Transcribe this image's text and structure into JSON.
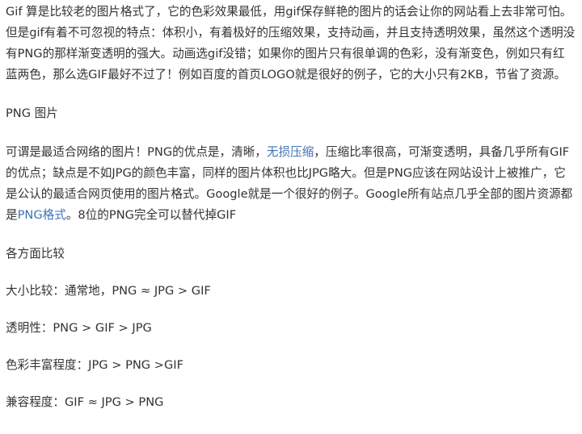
{
  "article": {
    "paragraph_gif": "Gif 算是比较老的图片格式了，它的色彩效果最低，用gif保存鲜艳的图片的话会让你的网站看上去非常可怕。但是gif有着不可忽视的特点：体积小，有着极好的压缩效果，支持动画，并且支持透明效果，虽然这个透明没有PNG的那样渐变透明的强大。动画选gif没错；如果你的图片只有很单调的色彩，没有渐变色，例如只有红蓝两色，那么选GIF最好不过了！例如百度的首页LOGO就是很好的例子，它的大小只有2KB，节省了资源。",
    "heading_png": "PNG 图片",
    "paragraph_png": {
      "part1": "可谓是最适合网络的图片！PNG的优点是，清晰，",
      "link1": "无损压缩",
      "part2": "，压缩比率很高，可渐变透明，具备几乎所有GIF的优点；缺点是不如JPG的颜色丰富，同样的图片体积也比JPG略大。但是PNG应该在网站设计上被推广，它是公认的最适合网页使用的图片格式。Google就是一个很好的例子。Google所有站点几乎全部的图片资源都是",
      "link2": "PNG格式",
      "part3": "。8位的PNG完全可以替代掉GIF"
    },
    "heading_compare": "各方面比较",
    "comparisons": [
      "大小比较：通常地，PNG ≈ JPG > GIF",
      "透明性：PNG > GIF > JPG",
      "色彩丰富程度：JPG > PNG >GIF",
      "兼容程度：GIF ≈ JPG > PNG"
    ],
    "link_color": "#3f73b7",
    "text_color": "#333333"
  }
}
